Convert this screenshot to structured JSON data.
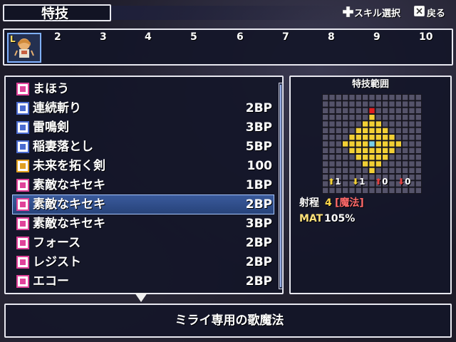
{
  "header": {
    "title": "特技",
    "controls": [
      {
        "icon": "dpad-icon",
        "label": "スキル選択"
      },
      {
        "icon": "cancel-button-icon",
        "label": "戻る"
      }
    ]
  },
  "level_bar": {
    "current_label": "L",
    "levels": [
      "2",
      "3",
      "4",
      "5",
      "6",
      "7",
      "8",
      "9",
      "10"
    ]
  },
  "skills": [
    {
      "name": "まほう",
      "cost": "",
      "icon": "magic-book-icon",
      "icon_color": "#e0429a"
    },
    {
      "name": "連続斬り",
      "cost": "2BP",
      "icon": "slash-skill-icon",
      "icon_color": "#4a6bd0"
    },
    {
      "name": "雷鳴剣",
      "cost": "3BP",
      "icon": "slash-skill-icon",
      "icon_color": "#4a6bd0"
    },
    {
      "name": "稲妻落とし",
      "cost": "5BP",
      "icon": "slash-skill-icon",
      "icon_color": "#4a6bd0"
    },
    {
      "name": "未来を拓く剣",
      "cost": "100",
      "icon": "sun-skill-icon",
      "icon_color": "#e0a020"
    },
    {
      "name": "素敵なキセキ",
      "cost": "1BP",
      "icon": "music-note-icon",
      "icon_color": "#e0429a"
    },
    {
      "name": "素敵なキセキ",
      "cost": "2BP",
      "icon": "song-plus-icon",
      "icon_color": "#e0429a"
    },
    {
      "name": "素敵なキセキ",
      "cost": "3BP",
      "icon": "song-plus2-icon",
      "icon_color": "#e0429a"
    },
    {
      "name": "フォース",
      "cost": "2BP",
      "icon": "vo-icon",
      "icon_color": "#e0429a"
    },
    {
      "name": "レジスト",
      "cost": "2BP",
      "icon": "vo-icon",
      "icon_color": "#e0429a"
    },
    {
      "name": "エコー",
      "cost": "2BP",
      "icon": "vo-icon",
      "icon_color": "#e0429a"
    }
  ],
  "selected_index": 6,
  "range_panel": {
    "title": "特技範囲",
    "height_stats": [
      "1",
      "1",
      "0",
      "0"
    ],
    "range_label": "射程",
    "range_value": "4",
    "range_type": "[魔法]",
    "mat_label": "MAT",
    "mat_value": "105%"
  },
  "description": "ミライ専用の歌魔法",
  "colors": {
    "panel_border": "#e8e8f0",
    "selection": "#3a5a9c",
    "range_fill": "#f2d035",
    "range_center": "#7ad0e8",
    "range_top": "#e02020",
    "range_type_color": "#ff6a6a",
    "range_value_color": "#ffd84a",
    "mat_color": "#ffe27a"
  }
}
